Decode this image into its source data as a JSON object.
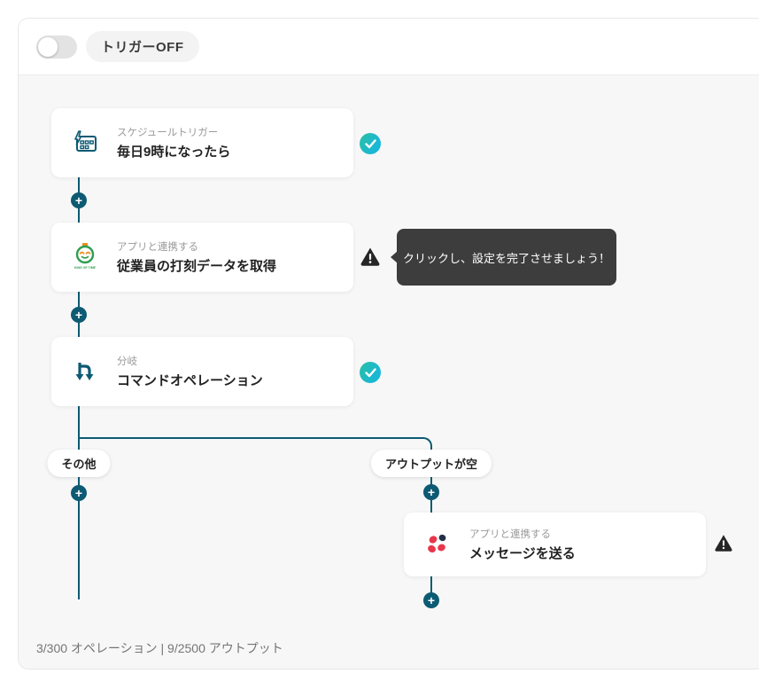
{
  "header": {
    "trigger_toggle": {
      "state": "off"
    },
    "trigger_label": "トリガーOFF"
  },
  "nodes": [
    {
      "type_label": "スケジュールトリガー",
      "title": "毎日9時になったら",
      "status": "complete",
      "icon": "calendar-lightning-icon"
    },
    {
      "type_label": "アプリと連携する",
      "title": "従業員の打刻データを取得",
      "status": "warning",
      "icon": "kingoftime-app-icon"
    },
    {
      "type_label": "分岐",
      "title": "コマンドオペレーション",
      "status": "complete",
      "icon": "branch-fork-icon"
    },
    {
      "type_label": "アプリと連携する",
      "title": "メッセージを送る",
      "status": "warning",
      "icon": "message-app-icon"
    }
  ],
  "tooltip": {
    "text": "クリックし、設定を完了させましょう！"
  },
  "branch_labels": [
    {
      "label": "その他"
    },
    {
      "label": "アウトプットが空"
    }
  ],
  "plus_button": {
    "label": "+"
  },
  "footer": {
    "status_text": "3/300 オペレーション | 9/2500 アウトプット"
  },
  "colors": {
    "connector": "#0d5a73",
    "canvas_bg": "#f7f7f7",
    "check_gradient_start": "#2bbfa4",
    "check_gradient_end": "#13b5e6",
    "warning": "#262626",
    "tooltip_bg": "#3d3d3d"
  }
}
